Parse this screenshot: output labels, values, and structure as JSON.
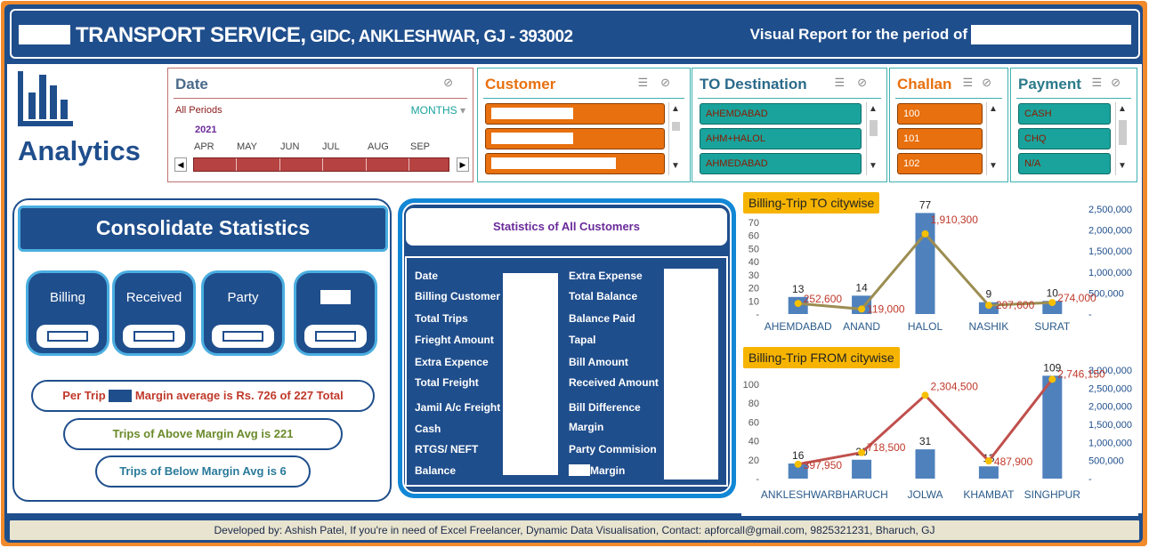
{
  "header": {
    "title_main": "TRANSPORT SERVICE,",
    "title_rest": " GIDC,  ANKLESHWAR, GJ - 393002",
    "report_label": "Visual Report for the period of"
  },
  "logo": {
    "text": "Analytics"
  },
  "slicers": {
    "date": {
      "title": "Date",
      "all_periods": "All Periods",
      "granularity": "MONTHS",
      "year": "2021",
      "months": [
        "APR",
        "MAY",
        "JUN",
        "JUL",
        "AUG",
        "SEP"
      ]
    },
    "customer": {
      "title": "Customer"
    },
    "destination": {
      "title": "TO Destination",
      "items": [
        "AHEMDABAD",
        "AHM+HALOL",
        "AHMEDABAD"
      ]
    },
    "challan": {
      "title": "Challan",
      "items": [
        "100",
        "101",
        "102"
      ]
    },
    "payment": {
      "title": "Payment",
      "items": [
        "CASH",
        "CHQ",
        "N/A"
      ]
    }
  },
  "consolidate": {
    "title": "Consolidate Statistics",
    "cards": [
      "Billing",
      "Received",
      "Party",
      ""
    ],
    "per_trip_prefix": "Per Trip",
    "per_trip_suffix": "Margin average is Rs. 726 of 227 Total",
    "above_avg": "Trips of Above Margin Avg is 221",
    "below_avg": "Trips of Below Margin Avg is 6"
  },
  "customers_stats": {
    "title": "Statistics of All Customers",
    "left_labels": [
      "Date",
      "Billing Customer",
      "Total Trips",
      "Frieght Amount",
      "Extra Expence",
      "Total Freight",
      "Jamil A/c Freight",
      "Cash",
      "RTGS/ NEFT",
      "Balance"
    ],
    "right_labels": [
      "Extra Expense",
      "Total Balance",
      "Balance Paid",
      "Tapal",
      "Bill Amount",
      "Received Amount",
      "Bill Difference",
      "Margin",
      "Party Commision",
      "Margin"
    ]
  },
  "charts_text": {
    "to_title": "Billing-Trip TO citywise",
    "from_title": "Billing-Trip FROM citywise"
  },
  "chart_data": [
    {
      "type": "bar",
      "title": "Billing-Trip TO citywise",
      "categories": [
        "AHEMDABAD",
        "ANAND",
        "HALOL",
        "NASHIK",
        "SURAT"
      ],
      "series": [
        {
          "type": "bar",
          "axis": "left",
          "values": [
            13,
            14,
            77,
            9,
            10
          ]
        },
        {
          "type": "line",
          "axis": "right",
          "values": [
            252600,
            119000,
            1910300,
            207600,
            274000
          ],
          "labels": [
            "252,600",
            "119,000",
            "1,910,300",
            "207,600",
            "274,000"
          ]
        }
      ],
      "ylim_left": [
        0,
        80
      ],
      "yticks_left": [
        "-",
        "10",
        "20",
        "30",
        "40",
        "50",
        "60",
        "70"
      ],
      "ylim_right": [
        0,
        2500000
      ],
      "yticks_right": [
        "-",
        "500,000",
        "1,000,000",
        "1,500,000",
        "2,000,000",
        "2,500,000"
      ],
      "colors": {
        "bar": "#4f81bd",
        "line": "#9c8d52",
        "marker": "#f6c000",
        "line_label": "#c0392b"
      }
    },
    {
      "type": "bar",
      "title": "Billing-Trip FROM citywise",
      "categories": [
        "ANKLESHWAR",
        "BHARUCH",
        "JOLWA",
        "KHAMBAT",
        "SINGHPUR"
      ],
      "series": [
        {
          "type": "bar",
          "axis": "left",
          "values": [
            16,
            20,
            31,
            13,
            109
          ]
        },
        {
          "type": "line",
          "axis": "right",
          "values": [
            397950,
            718500,
            2304500,
            487900,
            2746150
          ],
          "labels": [
            "397,950",
            "718,500",
            "2,304,500",
            "487,900",
            "2,746,150"
          ]
        }
      ],
      "ylim_left": [
        0,
        115
      ],
      "yticks_left": [
        "-",
        "20",
        "40",
        "60",
        "80",
        "100"
      ],
      "ylim_right": [
        0,
        3000000
      ],
      "yticks_right": [
        "-",
        "500,000",
        "1,000,000",
        "1,500,000",
        "2,000,000",
        "2,500,000",
        "3,000,000"
      ],
      "colors": {
        "bar": "#4f81bd",
        "line": "#c0504d",
        "marker": "#f6c000",
        "line_label": "#c0392b"
      }
    }
  ],
  "footer": {
    "text": "Developed by: Ashish Patel, If you're in need of Excel Freelancer, Dynamic Data Visualisation, Contact: apforcall@gmail.com, 9825321231, Bharuch, GJ"
  },
  "colors": {
    "navy": "#1f4e8c",
    "orange": "#e8700e",
    "teal": "#1aa39c",
    "date_title": "#4a6a8a",
    "customer_title": "#e8700e",
    "destination_title": "#2a6a8a",
    "challan_title": "#e8700e",
    "payment_title": "#2a7a8a",
    "per_trip_text": "#c0392b",
    "above_text": "#6b8a2a",
    "below_text": "#2a7a9a"
  }
}
